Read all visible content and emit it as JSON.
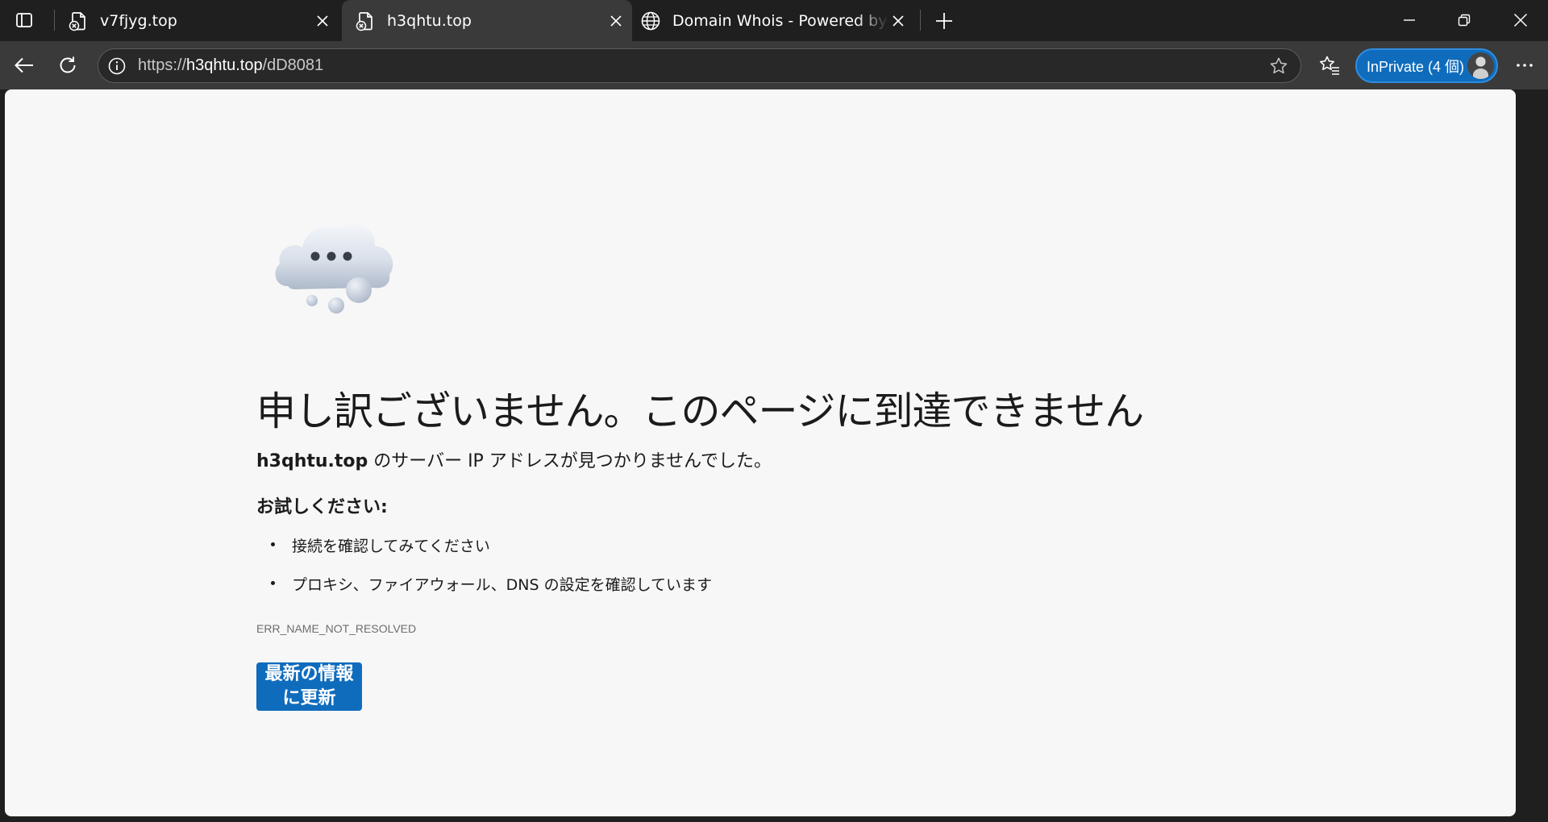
{
  "browser": {
    "tabs": [
      {
        "title": "v7fjyg.top",
        "favicon": "broken-page-icon",
        "active": false
      },
      {
        "title": "h3qhtu.top",
        "favicon": "broken-page-icon",
        "active": true
      },
      {
        "title": "Domain Whois - Powered by ZDNS",
        "favicon": "globe-icon",
        "active": false
      }
    ],
    "address": {
      "scheme": "https://",
      "host": "h3qhtu.top",
      "path": "/dD8081"
    },
    "inprivate_label": "InPrivate (4 個)"
  },
  "page": {
    "title": "申し訳ございません。このページに到達できません",
    "host_bold": "h3qhtu.top",
    "desc_rest": " のサーバー IP アドレスが見つかりませんでした。",
    "try_heading": "お試しください:",
    "suggestions": [
      "接続を確認してみてください",
      "プロキシ、ファイアウォール、DNS の設定を確認しています"
    ],
    "error_code": "ERR_NAME_NOT_RESOLVED",
    "refresh_label": "最新の情報に更新"
  },
  "colors": {
    "accent": "#0f6cbd",
    "page_background": "#f7f7f7",
    "chrome_dark": "#1f1f1f",
    "toolbar": "#3a3a3a"
  }
}
